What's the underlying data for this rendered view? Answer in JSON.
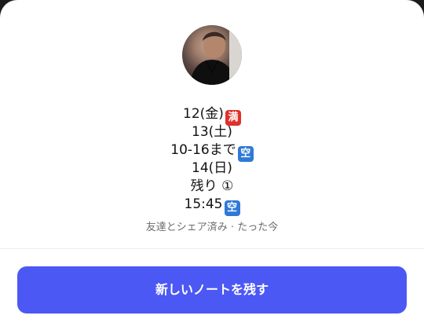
{
  "note": {
    "lines": [
      {
        "text": "12(金)",
        "emoji": {
          "glyph": "満",
          "color": "#e0302b"
        }
      },
      {
        "text": "13(土)"
      },
      {
        "text": "10-16まで",
        "emoji": {
          "glyph": "空",
          "color": "#2e79d6"
        }
      },
      {
        "text": "14(日)"
      },
      {
        "text": "残り ①"
      },
      {
        "text": "15:45",
        "emoji": {
          "glyph": "空",
          "color": "#2e79d6"
        }
      }
    ]
  },
  "status": "友達とシェア済み · たった今",
  "cta": {
    "label": "新しいノートを残す",
    "color": "#4b58f4"
  }
}
